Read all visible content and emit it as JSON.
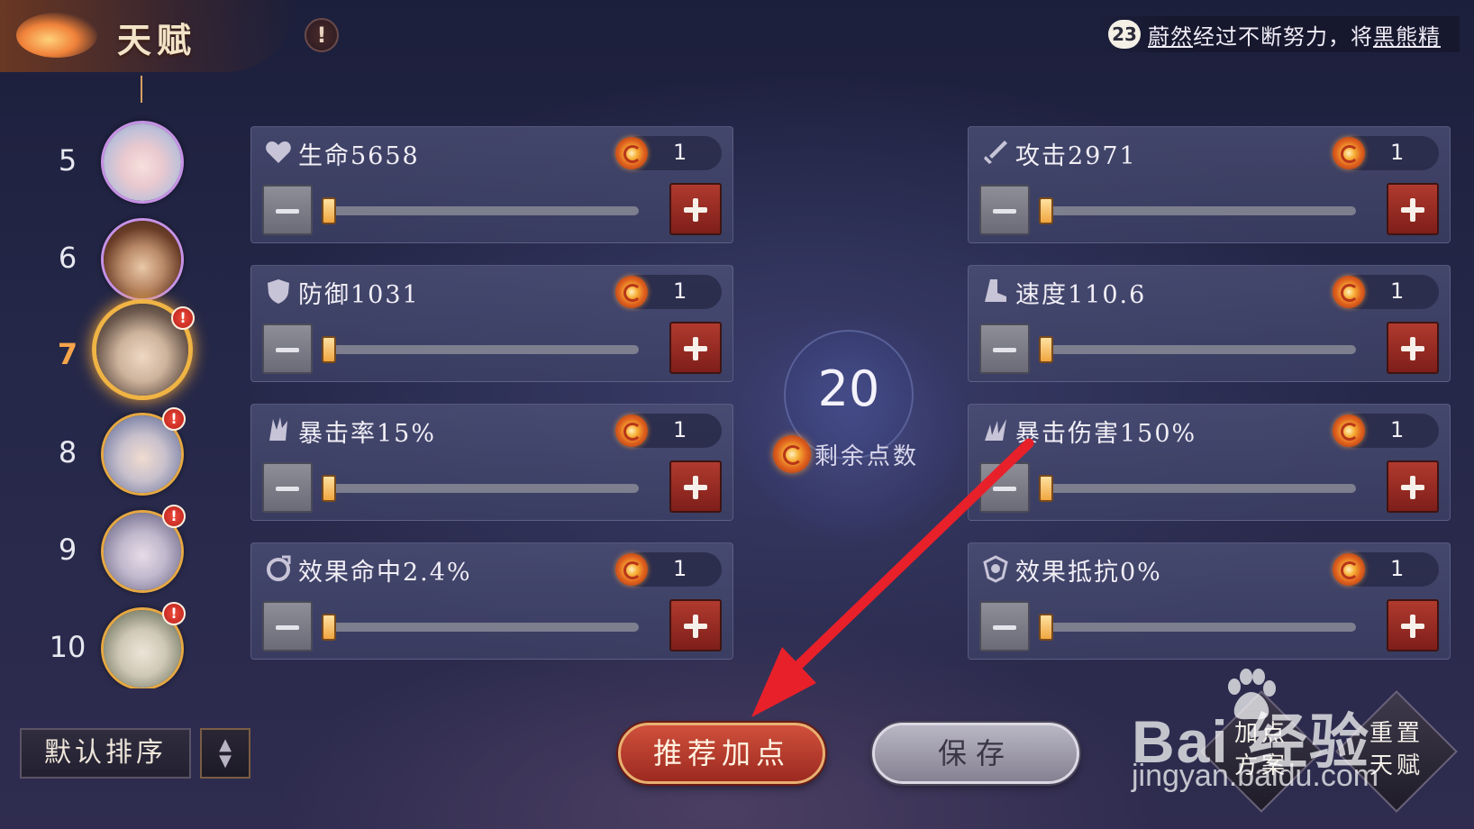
{
  "header": {
    "title": "天赋",
    "info_icon": "!",
    "marquee": {
      "badge": "23",
      "text_before": "",
      "name1": "蔚然",
      "text_middle": "经过不断努力，将",
      "name2": "黑熊精"
    }
  },
  "heroes": [
    {
      "level": "5",
      "frame": "purple",
      "active": false,
      "alert": false
    },
    {
      "level": "6",
      "frame": "purple",
      "active": false,
      "alert": false
    },
    {
      "level": "7",
      "frame": "gold",
      "active": true,
      "alert": true
    },
    {
      "level": "8",
      "frame": "gold",
      "active": false,
      "alert": true
    },
    {
      "level": "9",
      "frame": "gold",
      "active": false,
      "alert": true
    },
    {
      "level": "10",
      "frame": "gold",
      "active": false,
      "alert": true
    }
  ],
  "sort": {
    "label": "默认排序"
  },
  "stats": {
    "hp": {
      "label": "生命5658",
      "cost": "1",
      "icon": "heart-icon",
      "level": 0.02
    },
    "attack": {
      "label": "攻击2971",
      "cost": "1",
      "icon": "sword-icon",
      "level": 0.02
    },
    "defense": {
      "label": "防御1031",
      "cost": "1",
      "icon": "shield-icon",
      "level": 0.02
    },
    "speed": {
      "label": "速度110.6",
      "cost": "1",
      "icon": "boot-icon",
      "level": 0.02
    },
    "crit_rate": {
      "label": "暴击率15%",
      "cost": "1",
      "icon": "crit-rate-icon",
      "level": 0.02
    },
    "crit_damage": {
      "label": "暴击伤害150%",
      "cost": "1",
      "icon": "claw-icon",
      "level": 0.02
    },
    "effect_hit": {
      "label": "效果命中2.4%",
      "cost": "1",
      "icon": "target-icon",
      "level": 0.02
    },
    "effect_resist": {
      "label": "效果抵抗0%",
      "cost": "1",
      "icon": "resist-icon",
      "level": 0.02
    }
  },
  "remaining": {
    "value": "20",
    "label": "剩余点数"
  },
  "buttons": {
    "recommend": "推荐加点",
    "save": "保存",
    "plan_line1": "加点",
    "plan_line2": "方案",
    "reset_line1": "重置",
    "reset_line2": "天赋"
  },
  "watermark": {
    "brand": "Bai  经验",
    "url": "jingyan.baidu.com"
  },
  "colors": {
    "accent": "#f0b445",
    "plus": "#9c2a20",
    "annotation_arrow": "#e8202a"
  }
}
